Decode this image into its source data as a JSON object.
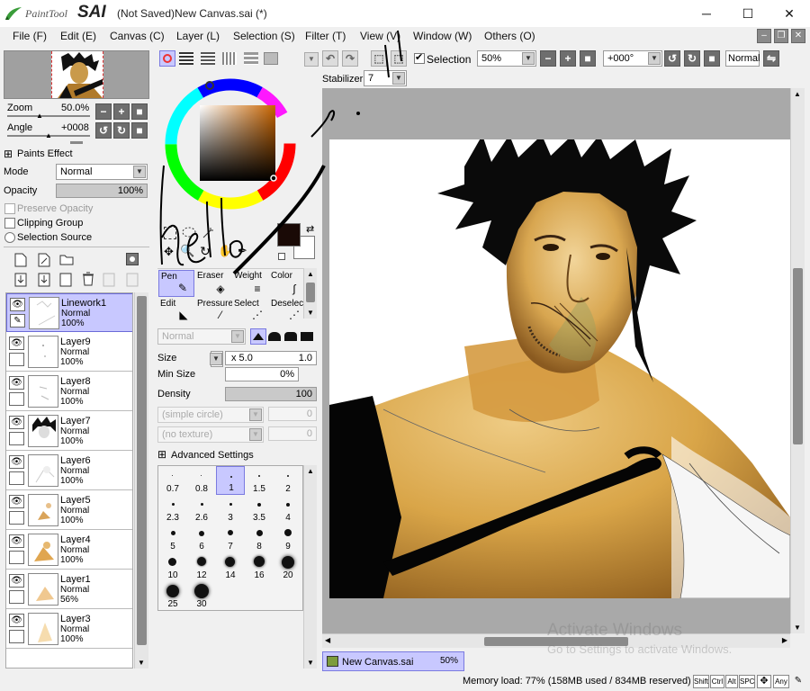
{
  "app": {
    "logo_small": "PaintTool",
    "logo_big": "SAI",
    "window_title": "(Not Saved)New Canvas.sai (*)"
  },
  "window_controls": {
    "minimize": "─",
    "maximize": "☐",
    "close": "✕"
  },
  "menu": [
    {
      "label": "File (F)"
    },
    {
      "label": "Edit (E)"
    },
    {
      "label": "Canvas (C)"
    },
    {
      "label": "Layer (L)"
    },
    {
      "label": "Selection (S)"
    },
    {
      "label": "Filter (T)"
    },
    {
      "label": "View (V)"
    },
    {
      "label": "Window (W)"
    },
    {
      "label": "Others (O)"
    }
  ],
  "navigator": {
    "zoom_label": "Zoom",
    "zoom_value": "50.0%",
    "angle_label": "Angle",
    "angle_value": "+0008"
  },
  "paints_effect": {
    "header": "Paints Effect",
    "mode_label": "Mode",
    "mode_value": "Normal",
    "opacity_label": "Opacity",
    "opacity_value": "100%",
    "preserve_opacity": "Preserve Opacity",
    "clipping_group": "Clipping Group",
    "selection_source": "Selection Source"
  },
  "layers": [
    {
      "name": "Linework1",
      "mode": "Normal",
      "opacity": "100%",
      "active": true
    },
    {
      "name": "Layer9",
      "mode": "Normal",
      "opacity": "100%"
    },
    {
      "name": "Layer8",
      "mode": "Normal",
      "opacity": "100%"
    },
    {
      "name": "Layer7",
      "mode": "Normal",
      "opacity": "100%"
    },
    {
      "name": "Layer6",
      "mode": "Normal",
      "opacity": "100%"
    },
    {
      "name": "Layer5",
      "mode": "Normal",
      "opacity": "100%"
    },
    {
      "name": "Layer4",
      "mode": "Normal",
      "opacity": "100%"
    },
    {
      "name": "Layer1",
      "mode": "Normal",
      "opacity": "56%"
    },
    {
      "name": "Layer3",
      "mode": "Normal",
      "opacity": "100%"
    }
  ],
  "toolbar": {
    "selection_label": "Selection",
    "zoom_value": "50%",
    "rotation_value": "+000°",
    "blend_mode": "Normal",
    "stabilizer_label": "Stabilizer",
    "stabilizer_value": "7"
  },
  "tools": {
    "row1": [
      {
        "name": "Pen",
        "icon": "pen-icon"
      },
      {
        "name": "Eraser",
        "icon": "eraser-icon"
      },
      {
        "name": "Weight",
        "icon": "weight-icon"
      },
      {
        "name": "Color",
        "icon": "color-icon"
      }
    ],
    "row2": [
      {
        "name": "Edit",
        "icon": "edit-icon"
      },
      {
        "name": "Pressure",
        "icon": "pressure-icon"
      },
      {
        "name": "Select",
        "icon": "select-icon"
      },
      {
        "name": "Deselect",
        "icon": "deselect-icon"
      }
    ]
  },
  "brush": {
    "blend_value": "Normal",
    "size_label": "Size",
    "size_multiplier": "x 5.0",
    "size_value": "1.0",
    "min_size_label": "Min Size",
    "min_size_value": "0%",
    "density_label": "Density",
    "density_value": "100",
    "shape_value": "(simple circle)",
    "shape_num": "0",
    "texture_value": "(no texture)",
    "texture_num": "0",
    "advanced_settings": "Advanced Settings",
    "sizes": [
      "0.7",
      "0.8",
      "1",
      "1.5",
      "2",
      "2.3",
      "2.6",
      "3",
      "3.5",
      "4",
      "5",
      "6",
      "7",
      "8",
      "9",
      "10",
      "12",
      "14",
      "16",
      "20",
      "25",
      "30"
    ],
    "selected_size": "1"
  },
  "document": {
    "tab_name": "New Canvas.sai",
    "tab_zoom": "50%"
  },
  "status": {
    "memory": "Memory load: 77% (158MB used / 834MB reserved)",
    "keys": [
      "Shift",
      "Ctrl",
      "Alt",
      "SPC",
      "✥",
      "Any",
      "✎"
    ]
  },
  "watermark": {
    "line1": "Activate Windows",
    "line2": "Go to Settings to activate Windows."
  },
  "colors": {
    "accent": "#c8c8ff",
    "primary_color": "#1a0a06",
    "secondary_color": "#ffffff"
  }
}
